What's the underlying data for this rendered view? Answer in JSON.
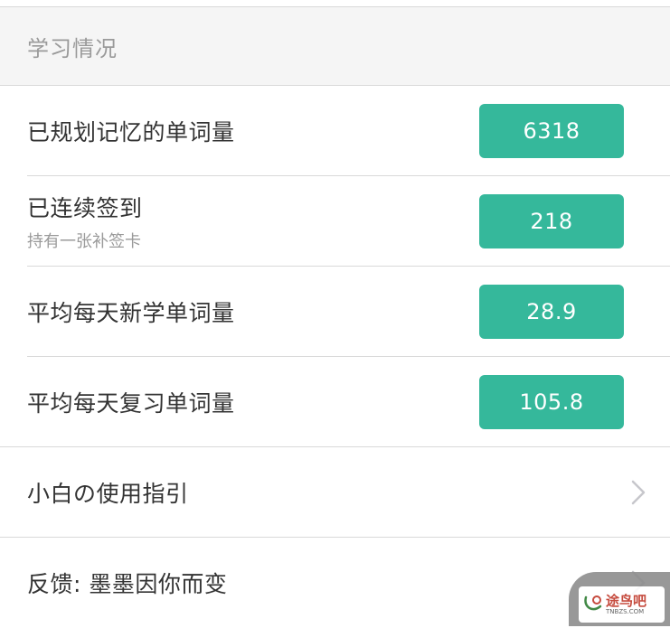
{
  "section": {
    "title": "学习情况"
  },
  "stats": [
    {
      "label": "已规划记忆的单词量",
      "sub": "",
      "value": "6318"
    },
    {
      "label": "已连续签到",
      "sub": "持有一张补签卡",
      "value": "218"
    },
    {
      "label": "平均每天新学单词量",
      "sub": "",
      "value": "28.9"
    },
    {
      "label": "平均每天复习单词量",
      "sub": "",
      "value": "105.8"
    }
  ],
  "nav": [
    {
      "label": "小白の使用指引",
      "icon": "chevron-right-icon"
    },
    {
      "label": "反馈: 墨墨因你而变",
      "icon": "chevron-right-icon"
    }
  ],
  "watermark": {
    "text": "途鸟吧",
    "sub": "TNBZS.COM"
  },
  "colors": {
    "accent": "#35b89b",
    "header_bg": "#f5f5f5",
    "divider": "#d9d9d9"
  }
}
